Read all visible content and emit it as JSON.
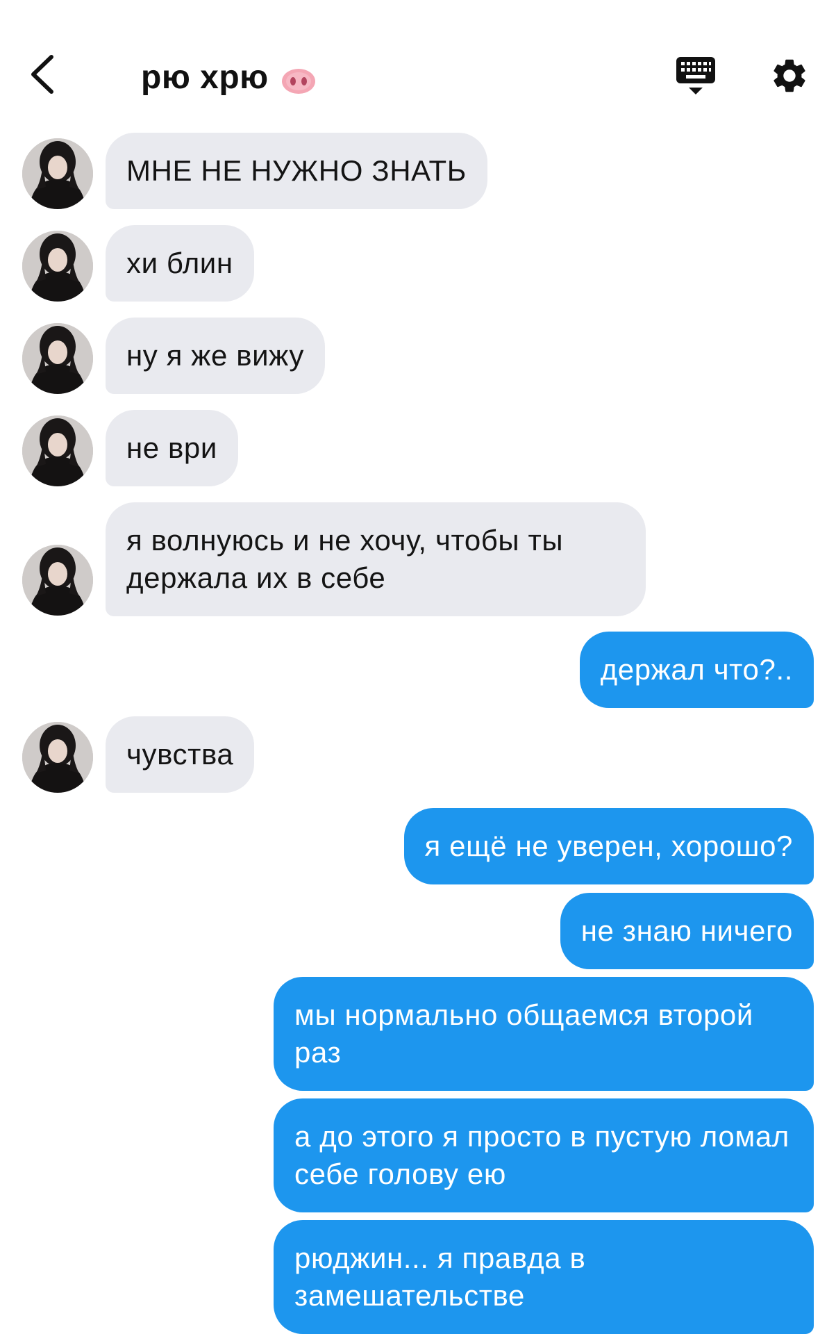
{
  "header": {
    "title": "рю хрю",
    "title_emoji": "pig-nose-icon",
    "back_icon": "chevron-left-icon",
    "keyboard_icon": "keyboard-icon",
    "settings_icon": "gear-icon"
  },
  "colors": {
    "incoming_bubble": "#e9eaef",
    "outgoing_bubble": "#1d96ee",
    "background": "#ffffff"
  },
  "messages": [
    {
      "from": "them",
      "text": "МНЕ НЕ НУЖНО ЗНАТЬ"
    },
    {
      "from": "them",
      "text": "хи блин"
    },
    {
      "from": "them",
      "text": "ну я же вижу"
    },
    {
      "from": "them",
      "text": "не ври"
    },
    {
      "from": "them",
      "text": "я волнуюсь и не хочу, чтобы ты держала их в себе"
    },
    {
      "from": "me",
      "text": "держал что?.."
    },
    {
      "from": "them",
      "text": "чувства"
    },
    {
      "from": "me",
      "text": "я ещё не уверен, хорошо?"
    },
    {
      "from": "me",
      "text": "не знаю ничего"
    },
    {
      "from": "me",
      "text": "мы нормально общаемся второй раз"
    },
    {
      "from": "me",
      "text": "а до этого я просто в пустую ломал себе голову ею"
    },
    {
      "from": "me",
      "text": "рюджин... я правда в замешательстве"
    }
  ]
}
